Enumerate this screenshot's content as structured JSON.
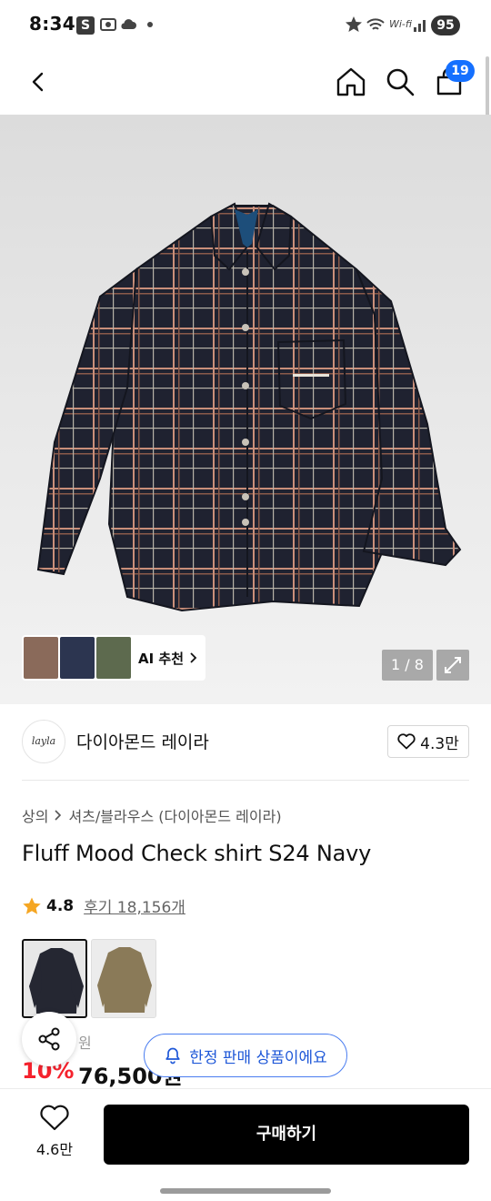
{
  "status_bar": {
    "time": "8:34",
    "s_badge": "S",
    "network": "Wi-fi",
    "battery": "95"
  },
  "header": {
    "cart_count": "19",
    "icons": [
      "back-icon",
      "home-icon",
      "search-icon",
      "cart-icon"
    ]
  },
  "gallery": {
    "ai_label": "AI 추천",
    "counter": "1 / 8",
    "thumb_colors": [
      "#8a6a5a",
      "#2c3550",
      "#5d6a4e"
    ]
  },
  "brand": {
    "logo_text": "layla",
    "name": "다이아몬드 레이라",
    "likes": "4.3만"
  },
  "breadcrumb": {
    "level1": "상의",
    "level2": "셔츠/블라우스 (다이아몬드 레이라)"
  },
  "product": {
    "title": "Fluff Mood Check shirt S24 Navy",
    "rating": "4.8",
    "reviews": "후기 18,156개",
    "original_price": "원",
    "discount": "10%",
    "price": "76,500원",
    "limited_label": "한정 판매 상품이에요"
  },
  "bottom_bar": {
    "like_count": "4.6만",
    "buy_label": "구매하기"
  },
  "colors": {
    "accent": "#1570ff",
    "discount": "#f5222d",
    "limited": "#1f58d8"
  }
}
